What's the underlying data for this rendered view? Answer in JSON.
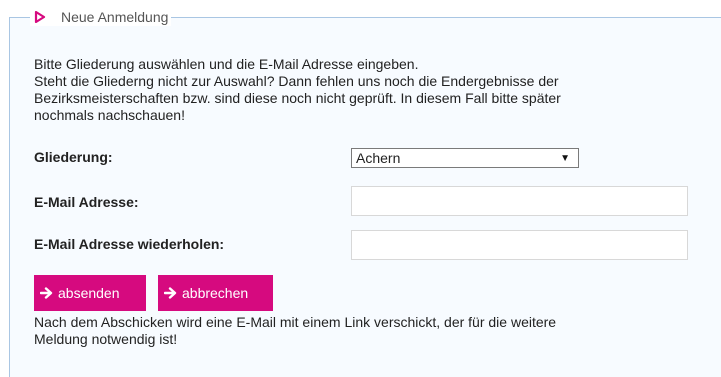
{
  "form": {
    "legend": "Neue Anmeldung",
    "intro_lines": [
      "Bitte Gliederung auswählen und die E-Mail Adresse eingeben.",
      "Steht die Gliederng nicht zur Auswahl? Dann fehlen uns noch die Endergebnisse der",
      "Bezirksmeisterschaften bzw. sind diese noch nicht geprüft. In diesem Fall bitte später",
      "nochmals nachschauen!"
    ],
    "fields": {
      "gliederung_label": "Gliederung:",
      "gliederung_value": "Achern",
      "email_label": "E-Mail Adresse:",
      "email_value": "",
      "email_repeat_label": "E-Mail Adresse wiederholen:",
      "email_repeat_value": ""
    },
    "buttons": {
      "submit_label": "absenden",
      "cancel_label": "abbrechen"
    },
    "note_lines": [
      "Nach dem Abschicken wird eine E-Mail mit einem Link verschickt, der für die weitere",
      "Meldung notwendig ist!"
    ]
  },
  "icons": {
    "legend": "play-triangle-icon",
    "button": "arrow-right-icon",
    "select": "caret-down-icon"
  },
  "colors": {
    "accent": "#d60a7f",
    "border": "#a9c6e3",
    "panel_background": "#f7fbff"
  }
}
